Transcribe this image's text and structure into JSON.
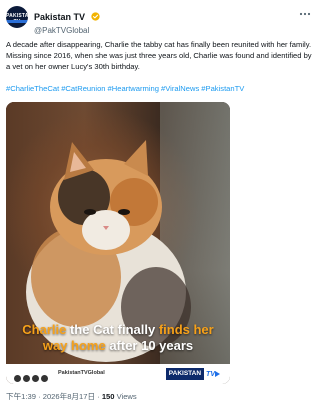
{
  "header": {
    "display_name": "Pakistan TV",
    "handle": "@PakTVGlobal",
    "avatar_text": "PAKISTAN TV"
  },
  "tweet": {
    "text": "A decade after disappearing, Charlie the tabby cat has finally been reunited with her family. Missing since 2016, when she was just three years old, Charlie was found and identified by a vet on her owner Lucy's 30th birthday.",
    "hashtags": [
      "#CharlieTheCat",
      "#CatReunion",
      "#Heartwarming",
      "#ViralNews",
      "#PakistanTV"
    ]
  },
  "media": {
    "caption_part1": "Charlie",
    "caption_part2": " the Cat finally ",
    "caption_part3": "finds her",
    "caption_part4": "way home",
    "caption_part5": " after 10 years",
    "footer_handle": "PakistanTVGlobal",
    "brand_name": "PAKISTAN",
    "brand_suffix": "TV"
  },
  "meta": {
    "time_date": "下午1:39 · 2026年8月17日 · ",
    "views_count": "150",
    "views_label": " Views"
  },
  "colors": {
    "link": "#1d9bf0",
    "caption_highlight": "#f6a11a",
    "verified": "#f2b300"
  },
  "icons": {
    "verified": "verified-badge-icon",
    "more": "more-options-icon"
  }
}
